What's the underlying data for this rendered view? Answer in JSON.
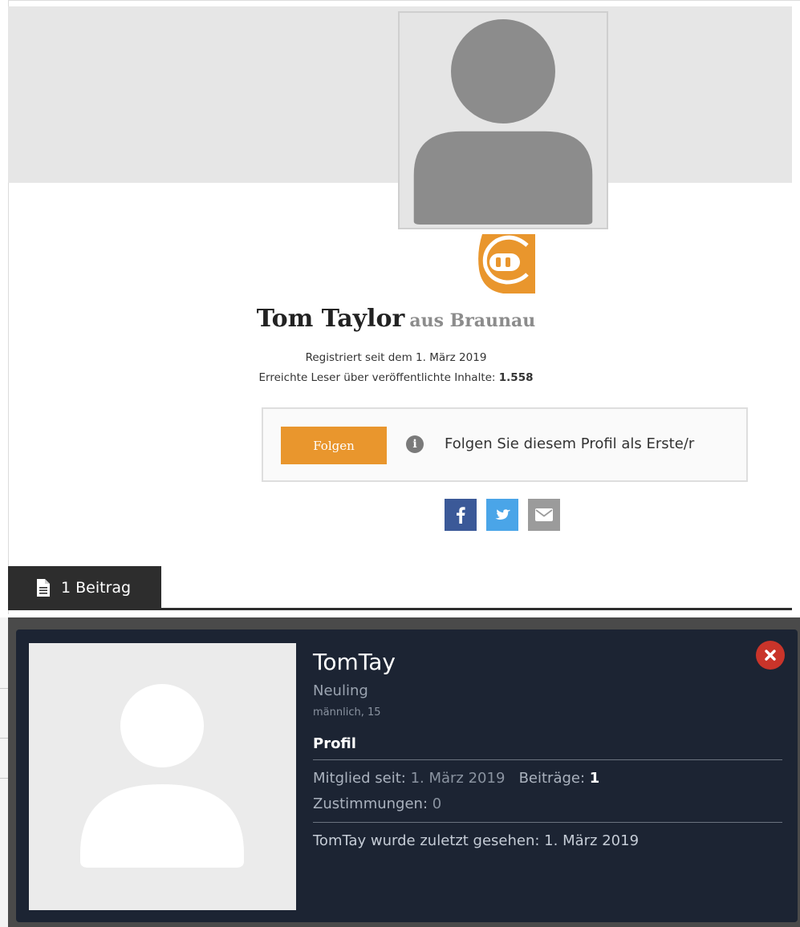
{
  "profile": {
    "name": "Tom Taylor",
    "location": "aus Braunau",
    "registered": "Registriert seit dem 1. März 2019",
    "readers_label": "Erreichte Leser über veröffentlichte Inhalte:",
    "readers_value": "1.558",
    "follow_label": "Folgen",
    "follow_hint": "Folgen Sie diesem Profil als Erste/r",
    "info_glyph": "i",
    "share_icons": [
      "facebook-icon",
      "twitter-icon",
      "mail-icon"
    ],
    "posts_tab": "1 Beitrag",
    "colors": {
      "accent": "#e9962d",
      "facebook": "#3b5998",
      "twitter": "#4aa5e8",
      "mail": "#9b9b9b",
      "tab": "#2d2d2d"
    }
  },
  "popup": {
    "username": "TomTay",
    "rank": "Neuling",
    "gender_age": "männlich, 15",
    "section_title": "Profil",
    "member_since_label": "Mitglied seit:",
    "member_since_value": "1. März 2019",
    "posts_label": "Beiträge:",
    "posts_value": "1",
    "likes_label": "Zustimmungen:",
    "likes_value": "0",
    "last_seen": "TomTay wurde zuletzt gesehen: 1. März 2019",
    "colors": {
      "background": "#1c2433",
      "close": "#c9342a"
    }
  }
}
